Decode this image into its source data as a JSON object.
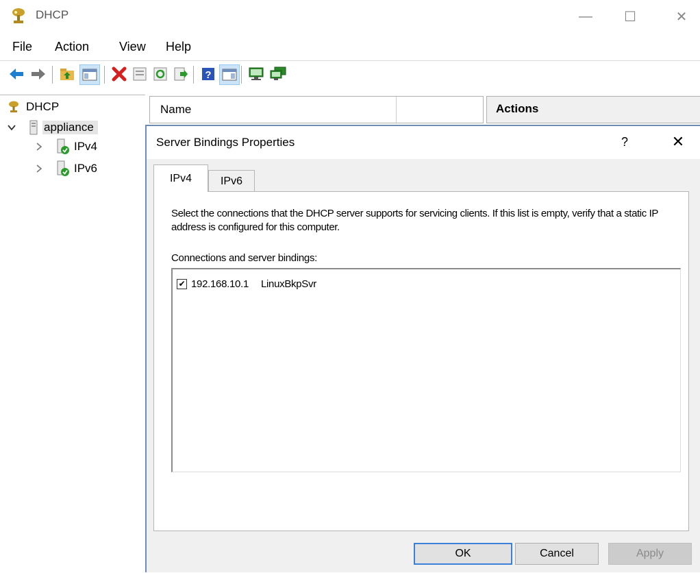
{
  "window": {
    "title": "DHCP",
    "controls": {
      "minimize": "—",
      "maximize": "☐",
      "close": "✕"
    }
  },
  "menu": {
    "items": [
      "File",
      "Action",
      "View",
      "Help"
    ]
  },
  "toolbar": {
    "buttons": [
      "back-arrow-icon",
      "forward-arrow-icon",
      "up-folder-icon",
      "show-hide-tree-icon",
      "delete-icon",
      "properties-icon",
      "refresh-icon",
      "export-list-icon",
      "help-icon",
      "show-hide-action-pane-icon",
      "server-icon",
      "add-server-icon"
    ]
  },
  "tree": {
    "root": "DHCP",
    "server": "appliance",
    "children": [
      "IPv4",
      "IPv6"
    ]
  },
  "list": {
    "column_name": "Name"
  },
  "actions": {
    "title": "Actions"
  },
  "dialog": {
    "title": "Server Bindings Properties",
    "help": "?",
    "close": "✕",
    "tabs": [
      "IPv4",
      "IPv6"
    ],
    "active_tab": "IPv4",
    "instructions": "Select the connections that the DHCP server supports for servicing clients. If this list is empty, verify that a static IP address is configured for this computer.",
    "bindings_label": "Connections and server bindings:",
    "bindings": [
      {
        "checked": true,
        "ip": "192.168.10.1",
        "name": "LinuxBkpSvr"
      }
    ],
    "buttons": {
      "ok": "OK",
      "cancel": "Cancel",
      "apply": "Apply"
    }
  },
  "colors": {
    "accent": "#3c7fd6",
    "dialog_border": "#6d8bb5",
    "dialog_bg": "#f0f0f0"
  }
}
